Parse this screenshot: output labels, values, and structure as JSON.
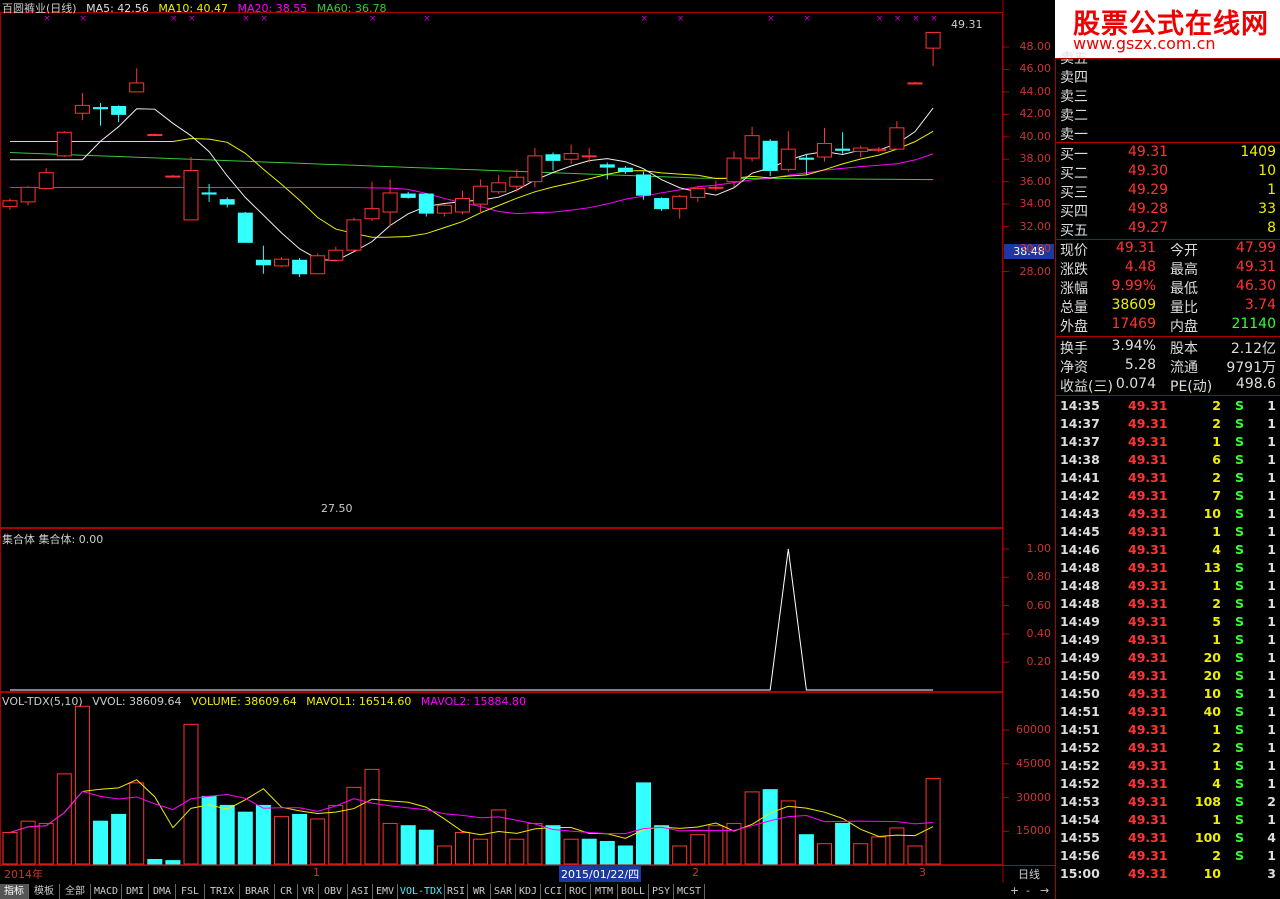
{
  "main_header": {
    "title": "百圆裤业(日线)",
    "ma5": "MA5: 42.56",
    "ma10": "MA10: 40.47",
    "ma20": "MA20: 38.55",
    "ma60": "MA60: 36.78"
  },
  "price_axis": [
    "48.00",
    "46.00",
    "44.00",
    "42.00",
    "40.00",
    "38.00",
    "36.00",
    "34.00",
    "32.00",
    "30.00",
    "28.00"
  ],
  "current_price_tag": "38.48",
  "high_label": "49.31",
  "low_label": "27.50",
  "indicator_header": "集合体 集合体: 0.00",
  "indicator_axis": [
    "1.00",
    "0.80",
    "0.60",
    "0.40",
    "0.20"
  ],
  "volume_header": {
    "name": "VOL-TDX(5,10)",
    "vvol": "VVOL: 38609.64",
    "volume": "VOLUME: 38609.64",
    "mavol1": "MAVOL1: 16514.60",
    "mavol2": "MAVOL2: 15884.80"
  },
  "volume_axis": [
    "60000",
    "45000",
    "30000",
    "15000"
  ],
  "date_axis": {
    "year": "2014年",
    "m1": "1",
    "cursor_date": "2015/01/22/四",
    "m2": "2",
    "m3": "3",
    "period": "日线"
  },
  "tabs": [
    "指标",
    "模板",
    "全部",
    "MACD",
    "DMI",
    "DMA",
    "FSL",
    "TRIX",
    "BRAR",
    "CR",
    "VR",
    "OBV",
    "ASI",
    "EMV",
    "VOL-TDX",
    "RSI",
    "WR",
    "SAR",
    "KDJ",
    "CCI",
    "ROC",
    "MTM",
    "BOLL",
    "PSY",
    "MCST"
  ],
  "active_tab": "VOL-TDX",
  "plus_minus": [
    "+",
    "-",
    "→"
  ],
  "logo": {
    "title": "股票公式在线网",
    "url": "www.gszx.com.cn"
  },
  "sell_orders": [
    {
      "label": "卖五",
      "price": "",
      "vol": ""
    },
    {
      "label": "卖四",
      "price": "",
      "vol": ""
    },
    {
      "label": "卖三",
      "price": "",
      "vol": ""
    },
    {
      "label": "卖二",
      "price": "",
      "vol": ""
    },
    {
      "label": "卖一",
      "price": "",
      "vol": ""
    }
  ],
  "buy_orders": [
    {
      "label": "买一",
      "price": "49.31",
      "vol": "1409"
    },
    {
      "label": "买二",
      "price": "49.30",
      "vol": "10"
    },
    {
      "label": "买三",
      "price": "49.29",
      "vol": "1"
    },
    {
      "label": "买四",
      "price": "49.28",
      "vol": "33"
    },
    {
      "label": "买五",
      "price": "49.27",
      "vol": "8"
    }
  ],
  "quote": [
    {
      "l1": "现价",
      "v1": "49.31",
      "l2": "今开",
      "v2": "47.99",
      "c1": "#f33",
      "c2": "#f33"
    },
    {
      "l1": "涨跌",
      "v1": "4.48",
      "l2": "最高",
      "v2": "49.31",
      "c1": "#f33",
      "c2": "#f33"
    },
    {
      "l1": "涨幅",
      "v1": "9.99%",
      "l2": "最低",
      "v2": "46.30",
      "c1": "#f33",
      "c2": "#f33"
    },
    {
      "l1": "总量",
      "v1": "38609",
      "l2": "量比",
      "v2": "3.74",
      "c1": "#ee0",
      "c2": "#f33"
    },
    {
      "l1": "外盘",
      "v1": "17469",
      "l2": "内盘",
      "v2": "21140",
      "c1": "#f33",
      "c2": "#3f3"
    },
    {
      "l1": "换手",
      "v1": "3.94%",
      "l2": "股本",
      "v2": "2.12亿",
      "c1": "#ddd",
      "c2": "#ddd"
    },
    {
      "l1": "净资",
      "v1": "5.28",
      "l2": "流通",
      "v2": "9791万",
      "c1": "#ddd",
      "c2": "#ddd"
    },
    {
      "l1": "收益(三)",
      "v1": "0.074",
      "l2": "PE(动)",
      "v2": "498.6",
      "c1": "#ddd",
      "c2": "#ddd"
    }
  ],
  "ticks": [
    {
      "t": "14:35",
      "p": "49.31",
      "v": "2",
      "s": "S",
      "n": "1"
    },
    {
      "t": "14:37",
      "p": "49.31",
      "v": "2",
      "s": "S",
      "n": "1"
    },
    {
      "t": "14:37",
      "p": "49.31",
      "v": "1",
      "s": "S",
      "n": "1"
    },
    {
      "t": "14:38",
      "p": "49.31",
      "v": "6",
      "s": "S",
      "n": "1"
    },
    {
      "t": "14:41",
      "p": "49.31",
      "v": "2",
      "s": "S",
      "n": "1"
    },
    {
      "t": "14:42",
      "p": "49.31",
      "v": "7",
      "s": "S",
      "n": "1"
    },
    {
      "t": "14:43",
      "p": "49.31",
      "v": "10",
      "s": "S",
      "n": "1"
    },
    {
      "t": "14:45",
      "p": "49.31",
      "v": "1",
      "s": "S",
      "n": "1"
    },
    {
      "t": "14:46",
      "p": "49.31",
      "v": "4",
      "s": "S",
      "n": "1"
    },
    {
      "t": "14:48",
      "p": "49.31",
      "v": "13",
      "s": "S",
      "n": "1"
    },
    {
      "t": "14:48",
      "p": "49.31",
      "v": "1",
      "s": "S",
      "n": "1"
    },
    {
      "t": "14:48",
      "p": "49.31",
      "v": "2",
      "s": "S",
      "n": "1"
    },
    {
      "t": "14:49",
      "p": "49.31",
      "v": "5",
      "s": "S",
      "n": "1"
    },
    {
      "t": "14:49",
      "p": "49.31",
      "v": "1",
      "s": "S",
      "n": "1"
    },
    {
      "t": "14:49",
      "p": "49.31",
      "v": "20",
      "s": "S",
      "n": "1"
    },
    {
      "t": "14:50",
      "p": "49.31",
      "v": "20",
      "s": "S",
      "n": "1"
    },
    {
      "t": "14:50",
      "p": "49.31",
      "v": "10",
      "s": "S",
      "n": "1"
    },
    {
      "t": "14:51",
      "p": "49.31",
      "v": "40",
      "s": "S",
      "n": "1"
    },
    {
      "t": "14:51",
      "p": "49.31",
      "v": "1",
      "s": "S",
      "n": "1"
    },
    {
      "t": "14:52",
      "p": "49.31",
      "v": "2",
      "s": "S",
      "n": "1"
    },
    {
      "t": "14:52",
      "p": "49.31",
      "v": "1",
      "s": "S",
      "n": "1"
    },
    {
      "t": "14:52",
      "p": "49.31",
      "v": "4",
      "s": "S",
      "n": "1"
    },
    {
      "t": "14:53",
      "p": "49.31",
      "v": "108",
      "s": "S",
      "n": "2"
    },
    {
      "t": "14:54",
      "p": "49.31",
      "v": "1",
      "s": "S",
      "n": "1"
    },
    {
      "t": "14:55",
      "p": "49.31",
      "v": "100",
      "s": "S",
      "n": "4"
    },
    {
      "t": "14:56",
      "p": "49.31",
      "v": "2",
      "s": "S",
      "n": "1"
    },
    {
      "t": "15:00",
      "p": "49.31",
      "v": "10",
      "s": "",
      "n": "3"
    }
  ],
  "chart_data": {
    "type": "candlestick",
    "price_range": [
      27,
      50
    ],
    "candles": [
      {
        "o": 33.8,
        "c": 34.3,
        "h": 34.5,
        "l": 33.5
      },
      {
        "o": 34.2,
        "c": 35.5,
        "h": 35.6,
        "l": 33.9
      },
      {
        "o": 35.4,
        "c": 36.8,
        "h": 37.2,
        "l": 35.3
      },
      {
        "o": 38.3,
        "c": 40.4,
        "h": 40.5,
        "l": 38.2
      },
      {
        "o": 42.1,
        "c": 42.8,
        "h": 43.9,
        "l": 41.5
      },
      {
        "o": 42.6,
        "c": 42.5,
        "h": 43.0,
        "l": 41.0
      },
      {
        "o": 42.7,
        "c": 42.0,
        "h": 42.8,
        "l": 41.3
      },
      {
        "o": 44.0,
        "c": 44.8,
        "h": 46.1,
        "l": 44.0
      },
      {
        "o": 40.2,
        "c": 40.2,
        "h": 40.3,
        "l": 40.1
      },
      {
        "o": 36.5,
        "c": 36.5,
        "h": 36.6,
        "l": 36.4
      },
      {
        "o": 32.6,
        "c": 37.0,
        "h": 38.2,
        "l": 32.6
      },
      {
        "o": 35.0,
        "c": 34.9,
        "h": 35.8,
        "l": 34.2
      },
      {
        "o": 34.4,
        "c": 34.0,
        "h": 34.6,
        "l": 33.7
      },
      {
        "o": 33.2,
        "c": 30.6,
        "h": 33.3,
        "l": 30.6
      },
      {
        "o": 29.0,
        "c": 28.6,
        "h": 30.3,
        "l": 27.8
      },
      {
        "o": 28.5,
        "c": 29.1,
        "h": 29.3,
        "l": 28.4
      },
      {
        "o": 29.0,
        "c": 27.8,
        "h": 29.2,
        "l": 27.5
      },
      {
        "o": 27.8,
        "c": 29.4,
        "h": 29.6,
        "l": 27.8
      },
      {
        "o": 29.0,
        "c": 29.9,
        "h": 30.2,
        "l": 28.9
      },
      {
        "o": 29.9,
        "c": 32.6,
        "h": 32.8,
        "l": 29.8
      },
      {
        "o": 32.7,
        "c": 33.6,
        "h": 36.0,
        "l": 32.5
      },
      {
        "o": 33.3,
        "c": 35.0,
        "h": 36.2,
        "l": 32.0
      },
      {
        "o": 34.9,
        "c": 34.6,
        "h": 35.1,
        "l": 34.5
      },
      {
        "o": 34.9,
        "c": 33.2,
        "h": 35.0,
        "l": 32.9
      },
      {
        "o": 33.2,
        "c": 33.9,
        "h": 34.0,
        "l": 32.9
      },
      {
        "o": 33.3,
        "c": 34.5,
        "h": 35.2,
        "l": 33.1
      },
      {
        "o": 34.0,
        "c": 35.6,
        "h": 36.2,
        "l": 33.2
      },
      {
        "o": 35.1,
        "c": 35.9,
        "h": 36.6,
        "l": 34.9
      },
      {
        "o": 35.6,
        "c": 36.4,
        "h": 37.1,
        "l": 35.1
      },
      {
        "o": 36.0,
        "c": 38.3,
        "h": 39.0,
        "l": 35.5
      },
      {
        "o": 38.4,
        "c": 37.9,
        "h": 38.6,
        "l": 37.0
      },
      {
        "o": 38.0,
        "c": 38.5,
        "h": 39.3,
        "l": 37.6
      },
      {
        "o": 38.3,
        "c": 38.3,
        "h": 39.0,
        "l": 37.7
      },
      {
        "o": 37.5,
        "c": 37.3,
        "h": 37.7,
        "l": 36.2
      },
      {
        "o": 37.2,
        "c": 36.9,
        "h": 37.4,
        "l": 36.7
      },
      {
        "o": 36.6,
        "c": 34.8,
        "h": 36.9,
        "l": 34.4
      },
      {
        "o": 34.5,
        "c": 33.6,
        "h": 34.6,
        "l": 33.4
      },
      {
        "o": 33.6,
        "c": 34.7,
        "h": 34.8,
        "l": 32.7
      },
      {
        "o": 34.6,
        "c": 35.4,
        "h": 35.6,
        "l": 34.2
      },
      {
        "o": 35.5,
        "c": 35.5,
        "h": 36.1,
        "l": 35.2
      },
      {
        "o": 36.0,
        "c": 38.1,
        "h": 38.7,
        "l": 35.5
      },
      {
        "o": 38.1,
        "c": 40.1,
        "h": 40.9,
        "l": 37.8
      },
      {
        "o": 39.6,
        "c": 37.0,
        "h": 39.8,
        "l": 36.5
      },
      {
        "o": 37.1,
        "c": 38.9,
        "h": 40.5,
        "l": 36.9
      },
      {
        "o": 38.1,
        "c": 38.0,
        "h": 38.5,
        "l": 36.6
      },
      {
        "o": 38.2,
        "c": 39.4,
        "h": 40.8,
        "l": 37.8
      },
      {
        "o": 38.9,
        "c": 38.8,
        "h": 40.4,
        "l": 38.5
      },
      {
        "o": 38.7,
        "c": 39.0,
        "h": 39.2,
        "l": 38.2
      },
      {
        "o": 38.8,
        "c": 38.9,
        "h": 39.1,
        "l": 38.6
      },
      {
        "o": 38.9,
        "c": 40.8,
        "h": 41.4,
        "l": 38.9
      },
      {
        "o": 44.8,
        "c": 44.8,
        "h": 44.9,
        "l": 44.7
      },
      {
        "o": 47.9,
        "c": 49.3,
        "h": 49.3,
        "l": 46.3
      }
    ],
    "volume_range": [
      0,
      72000
    ],
    "volumes": [
      14000,
      19000,
      18000,
      40000,
      70000,
      19000,
      22000,
      36000,
      2000,
      1500,
      62000,
      30000,
      26000,
      23000,
      26000,
      21000,
      22000,
      20000,
      26000,
      34000,
      42000,
      18000,
      17000,
      15000,
      8000,
      14000,
      11000,
      24000,
      11000,
      18000,
      17000,
      11000,
      11000,
      10000,
      8000,
      36000,
      17000,
      8000,
      13000,
      17000,
      18000,
      32000,
      33000,
      28000,
      13000,
      9000,
      18000,
      9000,
      12000,
      16000,
      8000,
      38000
    ],
    "volume_up": [
      true,
      true,
      true,
      true,
      true,
      false,
      false,
      true,
      false,
      false,
      true,
      false,
      false,
      false,
      false,
      true,
      false,
      true,
      true,
      true,
      true,
      true,
      false,
      false,
      true,
      true,
      true,
      true,
      true,
      true,
      false,
      true,
      false,
      false,
      false,
      false,
      false,
      true,
      true,
      true,
      true,
      true,
      false,
      true,
      false,
      true,
      false,
      true,
      true,
      true,
      true,
      true
    ],
    "indicator_peak_index": 43,
    "indicator_range": [
      0,
      1.1
    ]
  }
}
